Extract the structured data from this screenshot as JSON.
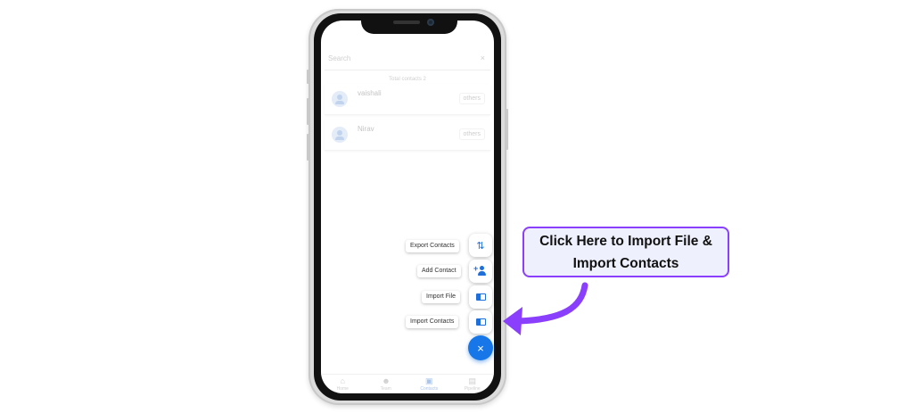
{
  "app": {
    "search_placeholder": "Search",
    "clear_glyph": "×",
    "total_contacts": "Total contacts 2",
    "contacts": [
      {
        "name": "vaishali",
        "tag": "others"
      },
      {
        "name": "Nirav",
        "tag": "others"
      }
    ],
    "nav": [
      {
        "label": "Home",
        "icon": "home-icon"
      },
      {
        "label": "Team",
        "icon": "team-icon"
      },
      {
        "label": "Contacts",
        "icon": "contacts-icon",
        "active": true
      },
      {
        "label": "Pipeline",
        "icon": "pipeline-icon"
      }
    ]
  },
  "fab_menu": {
    "items": [
      {
        "label": "Export Contacts",
        "icon": "export-icon",
        "glyph": "⇅"
      },
      {
        "label": "Add Contact",
        "icon": "add-person-icon",
        "glyph": "+"
      },
      {
        "label": "Import File",
        "icon": "import-file-icon"
      },
      {
        "label": "Import Contacts",
        "icon": "import-contacts-icon"
      }
    ],
    "close_glyph": "×"
  },
  "callout": {
    "line1": "Click Here to Import File &",
    "line2": "Import Contacts"
  },
  "colors": {
    "accent": "#1877e8",
    "callout_border": "#8a3ffc",
    "callout_bg": "#eef1fd",
    "arrow": "#8a3ffc"
  }
}
